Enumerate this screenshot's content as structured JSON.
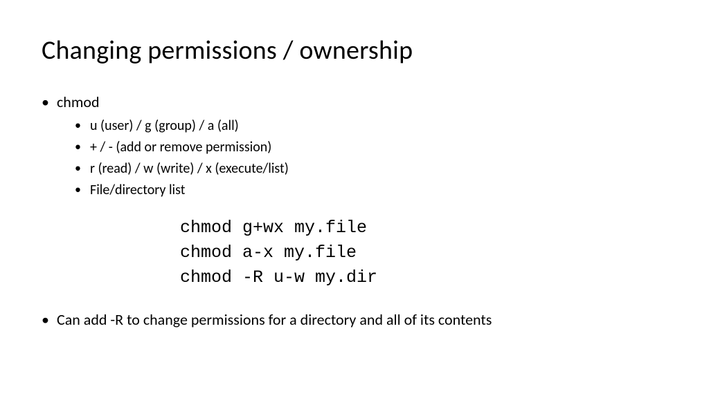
{
  "title": "Changing permissions / ownership",
  "bullets": {
    "item1": "chmod",
    "sub1": "u (user) / g (group) / a (all)",
    "sub2": "+ / -  (add or remove permission)",
    "sub3": "r (read) / w (write) / x (execute/list)",
    "sub4": "File/directory list",
    "item2": "Can add -R to change permissions for a directory and all of its contents"
  },
  "code": {
    "line1": "chmod g+wx my.file",
    "line2": "chmod a-x my.file",
    "line3": "chmod -R u-w my.dir"
  }
}
